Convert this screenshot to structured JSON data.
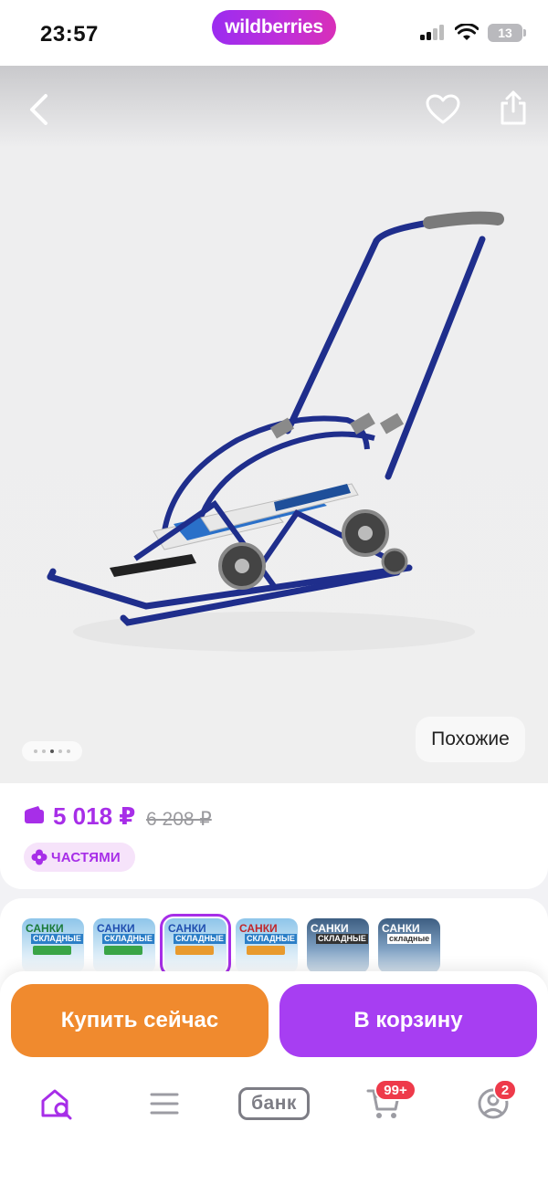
{
  "status_bar": {
    "time": "23:57",
    "brand": "wildberries",
    "battery": "13",
    "icons": [
      "signal-icon",
      "wifi-icon",
      "battery-icon"
    ]
  },
  "product": {
    "nav": {
      "back_icon": "chevron-left-icon",
      "favorite_icon": "heart-icon",
      "share_icon": "share-icon"
    },
    "gallery": {
      "current_index": 3,
      "total": 5
    },
    "similar_label": "Похожие",
    "price": "5 018 ₽",
    "old_price": "6 208 ₽",
    "installments_label": "ЧАСТЯМИ"
  },
  "variants": [
    {
      "title": "САНКИ",
      "subtitle": "СКЛАДНЫЕ",
      "selected": false
    },
    {
      "title": "САНКИ",
      "subtitle": "СКЛАДНЫЕ",
      "selected": false
    },
    {
      "title": "САНКИ",
      "subtitle": "СКЛАДНЫЕ",
      "selected": true
    },
    {
      "title": "САНКИ",
      "subtitle": "СКЛАДНЫЕ",
      "selected": false
    },
    {
      "title": "САНКИ",
      "subtitle": "СКЛАДНЫЕ",
      "selected": false
    },
    {
      "title": "САНКИ",
      "subtitle": "складные",
      "selected": false
    }
  ],
  "actions": {
    "buy_now": "Купить сейчас",
    "add_to_cart": "В корзину"
  },
  "tabbar": {
    "home_icon": "home-search-icon",
    "catalog_icon": "menu-icon",
    "bank_label": "банк",
    "cart_badge": "99+",
    "profile_badge": "2"
  },
  "colors": {
    "accent": "#a72ee8",
    "buy_button": "#f08a2e",
    "cart_button": "#a73ef2",
    "badge": "#ee3a4a"
  }
}
